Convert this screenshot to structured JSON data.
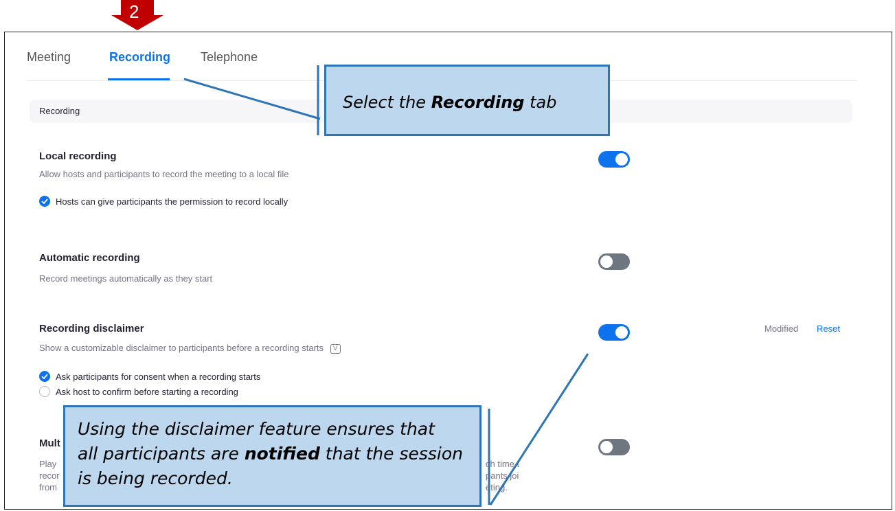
{
  "step_marker": "2",
  "tabs": [
    {
      "label": "Meeting"
    },
    {
      "label": "Recording"
    },
    {
      "label": "Telephone"
    }
  ],
  "section": {
    "label": "Recording"
  },
  "settings": {
    "local": {
      "title": "Local recording",
      "desc": "Allow hosts and participants to record the meeting to a local file",
      "toggle_on": true,
      "option1": "Hosts can give participants the permission to record locally"
    },
    "auto": {
      "title": "Automatic recording",
      "desc": "Record meetings automatically as they start",
      "toggle_on": false
    },
    "disclaimer": {
      "title": "Recording disclaimer",
      "desc": "Show a customizable disclaimer to participants before a recording starts",
      "toggle_on": true,
      "modified": "Modified",
      "reset": "Reset",
      "option1": "Ask participants for consent when a recording starts",
      "option2": "Ask host to confirm before starting a recording"
    },
    "multi": {
      "title_fragment": "Mult",
      "desc_left": [
        "Play",
        "recor",
        "from"
      ],
      "desc_right": [
        "ch time t",
        "pants joi",
        "eting."
      ],
      "toggle_on": false
    }
  },
  "callouts": {
    "tab_prefix": "Select the ",
    "tab_bold": "Recording",
    "tab_suffix": " tab",
    "disclaimer_l1": "Using the disclaimer feature ensures that",
    "disclaimer_l2a": "all participants are ",
    "disclaimer_l2b": "notified",
    "disclaimer_l2c": " that the session",
    "disclaimer_l3": "is being recorded."
  },
  "colors": {
    "accent": "#0e72ed",
    "marker": "#c00000",
    "callout_fill": "#bdd7ee",
    "callout_border": "#2e75b6"
  }
}
